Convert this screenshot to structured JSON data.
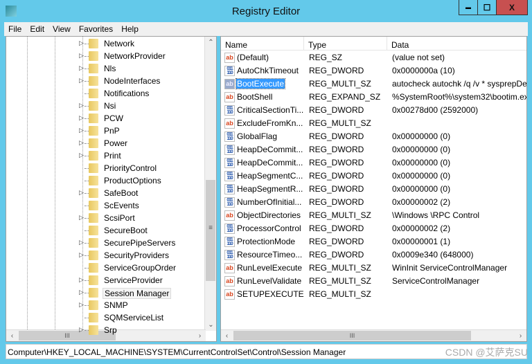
{
  "window": {
    "title": "Registry Editor",
    "minimize": "▬",
    "maximize": "☐",
    "close": "X",
    "accent": "#63c9ea",
    "close_color": "#c75050"
  },
  "menu": [
    "File",
    "Edit",
    "View",
    "Favorites",
    "Help"
  ],
  "tree": [
    {
      "label": "Network",
      "expandable": true
    },
    {
      "label": "NetworkProvider",
      "expandable": true
    },
    {
      "label": "Nls",
      "expandable": true
    },
    {
      "label": "NodeInterfaces",
      "expandable": true
    },
    {
      "label": "Notifications",
      "expandable": false
    },
    {
      "label": "Nsi",
      "expandable": true
    },
    {
      "label": "PCW",
      "expandable": true
    },
    {
      "label": "PnP",
      "expandable": true
    },
    {
      "label": "Power",
      "expandable": true
    },
    {
      "label": "Print",
      "expandable": true
    },
    {
      "label": "PriorityControl",
      "expandable": false
    },
    {
      "label": "ProductOptions",
      "expandable": false
    },
    {
      "label": "SafeBoot",
      "expandable": true
    },
    {
      "label": "ScEvents",
      "expandable": false
    },
    {
      "label": "ScsiPort",
      "expandable": true
    },
    {
      "label": "SecureBoot",
      "expandable": false
    },
    {
      "label": "SecurePipeServers",
      "expandable": true
    },
    {
      "label": "SecurityProviders",
      "expandable": true
    },
    {
      "label": "ServiceGroupOrder",
      "expandable": false
    },
    {
      "label": "ServiceProvider",
      "expandable": true
    },
    {
      "label": "Session Manager",
      "expandable": true,
      "selected": true
    },
    {
      "label": "SNMP",
      "expandable": true
    },
    {
      "label": "SQMServiceList",
      "expandable": false
    },
    {
      "label": "Srp",
      "expandable": true
    }
  ],
  "columns": {
    "name": "Name",
    "type": "Type",
    "data": "Data"
  },
  "values": [
    {
      "name": "(Default)",
      "type": "REG_SZ",
      "data": "(value not set)"
    },
    {
      "name": "AutoChkTimeout",
      "type": "REG_DWORD",
      "data": "0x0000000a (10)"
    },
    {
      "name": "BootExecute",
      "type": "REG_MULTI_SZ",
      "data": "autocheck autochk /q /v * sysprepDe",
      "selected": true
    },
    {
      "name": "BootShell",
      "type": "REG_EXPAND_SZ",
      "data": "%SystemRoot%\\system32\\bootim.ex"
    },
    {
      "name": "CriticalSectionTi...",
      "type": "REG_DWORD",
      "data": "0x00278d00 (2592000)"
    },
    {
      "name": "ExcludeFromKn...",
      "type": "REG_MULTI_SZ",
      "data": ""
    },
    {
      "name": "GlobalFlag",
      "type": "REG_DWORD",
      "data": "0x00000000 (0)"
    },
    {
      "name": "HeapDeCommit...",
      "type": "REG_DWORD",
      "data": "0x00000000 (0)"
    },
    {
      "name": "HeapDeCommit...",
      "type": "REG_DWORD",
      "data": "0x00000000 (0)"
    },
    {
      "name": "HeapSegmentC...",
      "type": "REG_DWORD",
      "data": "0x00000000 (0)"
    },
    {
      "name": "HeapSegmentR...",
      "type": "REG_DWORD",
      "data": "0x00000000 (0)"
    },
    {
      "name": "NumberOfInitial...",
      "type": "REG_DWORD",
      "data": "0x00000002 (2)"
    },
    {
      "name": "ObjectDirectories",
      "type": "REG_MULTI_SZ",
      "data": "\\Windows \\RPC Control"
    },
    {
      "name": "ProcessorControl",
      "type": "REG_DWORD",
      "data": "0x00000002 (2)"
    },
    {
      "name": "ProtectionMode",
      "type": "REG_DWORD",
      "data": "0x00000001 (1)"
    },
    {
      "name": "ResourceTimeo...",
      "type": "REG_DWORD",
      "data": "0x0009e340 (648000)"
    },
    {
      "name": "RunLevelExecute",
      "type": "REG_MULTI_SZ",
      "data": "WinInit ServiceControlManager"
    },
    {
      "name": "RunLevelValidate",
      "type": "REG_MULTI_SZ",
      "data": "ServiceControlManager"
    },
    {
      "name": "SETUPEXECUTE",
      "type": "REG_MULTI_SZ",
      "data": ""
    }
  ],
  "status": "Computer\\HKEY_LOCAL_MACHINE\\SYSTEM\\CurrentControlSet\\Control\\Session Manager",
  "watermark": "CSDN @艾萨克SU"
}
